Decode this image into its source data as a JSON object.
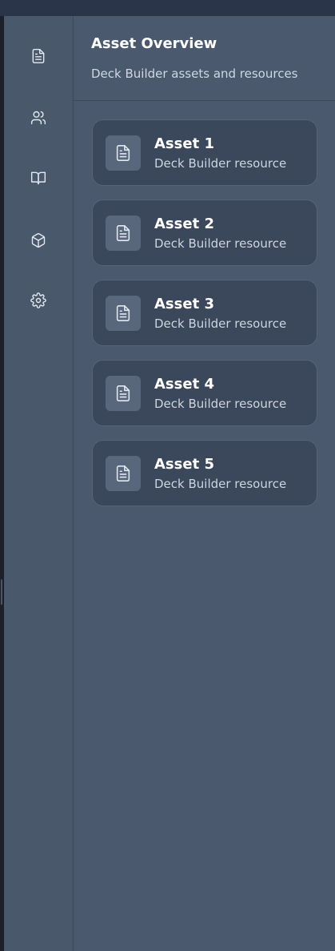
{
  "colors": {
    "rail_bg": "#4a586b",
    "panel_bg": "#4a596d",
    "card_bg": "#3b475a",
    "icon_stroke": "#e3e8ef"
  },
  "rail": {
    "items": [
      {
        "icon": "file-text-icon"
      },
      {
        "icon": "users-icon"
      },
      {
        "icon": "book-open-icon"
      },
      {
        "icon": "box-icon"
      },
      {
        "icon": "settings-icon"
      }
    ]
  },
  "panel": {
    "title": "Asset Overview",
    "subtitle": "Deck Builder assets and resources"
  },
  "assets": [
    {
      "name": "Asset 1",
      "description": "Deck Builder resource",
      "icon": "file-text-icon"
    },
    {
      "name": "Asset 2",
      "description": "Deck Builder resource",
      "icon": "file-text-icon"
    },
    {
      "name": "Asset 3",
      "description": "Deck Builder resource",
      "icon": "file-text-icon"
    },
    {
      "name": "Asset 4",
      "description": "Deck Builder resource",
      "icon": "file-text-icon"
    },
    {
      "name": "Asset 5",
      "description": "Deck Builder resource",
      "icon": "file-text-icon"
    }
  ]
}
